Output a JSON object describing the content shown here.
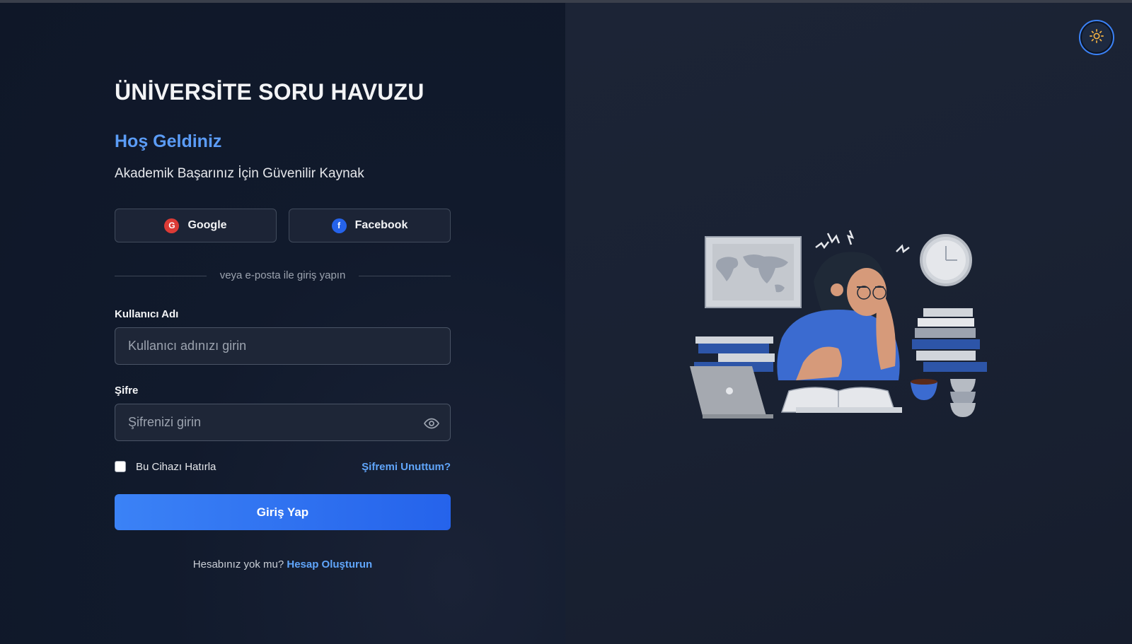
{
  "app": {
    "title": "ÜNİVERSİTE SORU HAVUZU"
  },
  "hero": {
    "welcome": "Hoş Geldiniz",
    "tagline": "Akademik Başarınız İçin Güvenilir Kaynak"
  },
  "social": {
    "google": {
      "label": "Google",
      "badge": "G",
      "icon": "google-icon"
    },
    "facebook": {
      "label": "Facebook",
      "badge": "f",
      "icon": "facebook-icon"
    }
  },
  "divider": {
    "text": "veya e-posta ile giriş yapın"
  },
  "form": {
    "username": {
      "label": "Kullanıcı Adı",
      "placeholder": "Kullanıcı adınızı girin",
      "value": ""
    },
    "password": {
      "label": "Şifre",
      "placeholder": "Şifrenizi girin",
      "value": "",
      "toggle_icon": "eye-icon"
    },
    "remember_label": "Bu Cihazı Hatırla",
    "remember_checked": false,
    "forgot_label": "Şifremi Unuttum?",
    "submit_label": "Giriş Yap"
  },
  "signup": {
    "prompt": "Hesabınız yok mu?",
    "link_label": "Hesap Oluşturun"
  },
  "theme_toggle": {
    "icon": "sun-icon"
  },
  "colors": {
    "accent": "#3b82f6",
    "link": "#60a5fa",
    "welcome": "#5b9cf6",
    "background": "#0f1627",
    "google": "#dc3b36",
    "facebook": "#2563eb"
  }
}
